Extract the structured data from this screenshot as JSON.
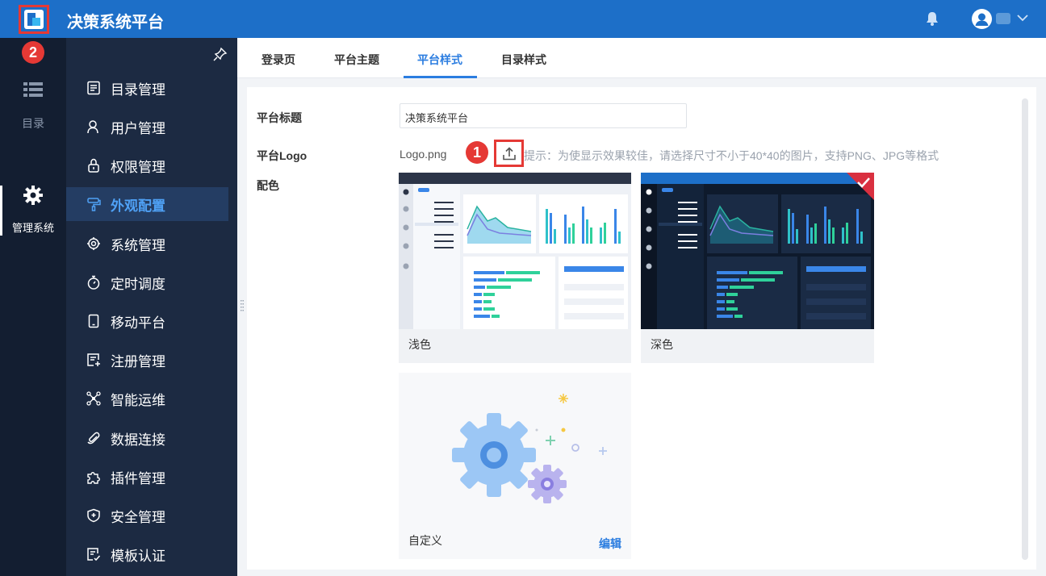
{
  "app": {
    "title": "决策系统平台"
  },
  "badges": {
    "one": "1",
    "two": "2"
  },
  "rail": {
    "catalog_label": "目录",
    "admin_label": "管理系统"
  },
  "sidebar": {
    "items": [
      {
        "label": "目录管理",
        "icon": "list-doc-icon"
      },
      {
        "label": "用户管理",
        "icon": "user-icon"
      },
      {
        "label": "权限管理",
        "icon": "lock-icon"
      },
      {
        "label": "外观配置",
        "icon": "paint-roller-icon",
        "active": true
      },
      {
        "label": "系统管理",
        "icon": "gear-icon"
      },
      {
        "label": "定时调度",
        "icon": "stopwatch-icon"
      },
      {
        "label": "移动平台",
        "icon": "tablet-icon"
      },
      {
        "label": "注册管理",
        "icon": "register-icon"
      },
      {
        "label": "智能运维",
        "icon": "network-icon"
      },
      {
        "label": "数据连接",
        "icon": "paperclip-icon"
      },
      {
        "label": "插件管理",
        "icon": "puzzle-icon"
      },
      {
        "label": "安全管理",
        "icon": "shield-icon"
      },
      {
        "label": "模板认证",
        "icon": "template-cert-icon"
      }
    ]
  },
  "tabs": [
    {
      "label": "登录页"
    },
    {
      "label": "平台主题"
    },
    {
      "label": "平台样式",
      "active": true
    },
    {
      "label": "目录样式"
    }
  ],
  "form": {
    "title_label": "平台标题",
    "title_value": "决策系统平台",
    "logo_label": "平台Logo",
    "logo_file": "Logo.png",
    "hint": "提示：为使显示效果较佳，请选择尺寸不小于40*40的图片，支持PNG、JPG等格式",
    "color_label": "配色"
  },
  "themes": {
    "light_label": "浅色",
    "dark_label": "深色",
    "custom_label": "自定义",
    "edit_label": "编辑",
    "selected": "深色"
  },
  "colors": {
    "primary": "#1d6fc8",
    "accent": "#2b7de0",
    "highlight": "#e53935",
    "rail_bg": "#131e31",
    "sidebar_bg": "#1c2a42"
  }
}
